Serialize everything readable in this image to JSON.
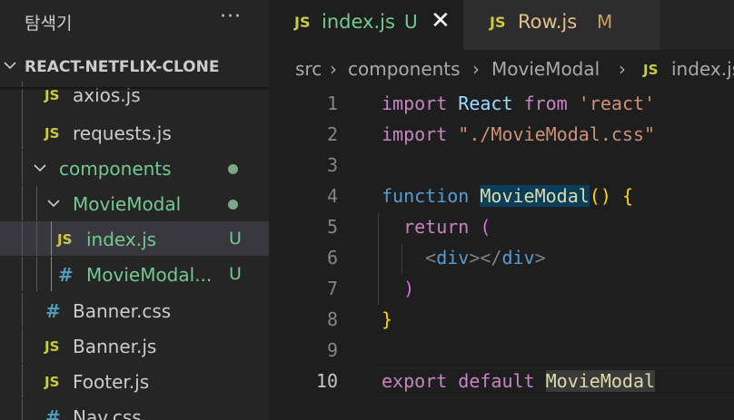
{
  "sidebar": {
    "title": "탐색기",
    "more": "···",
    "project": "REACT-NETFLIX-CLONE",
    "items": [
      {
        "type": "js",
        "name": "axios.js"
      },
      {
        "type": "js",
        "name": "requests.js"
      },
      {
        "type": "folder",
        "name": "components"
      },
      {
        "type": "folder",
        "name": "MovieModal"
      },
      {
        "type": "js",
        "name": "index.js",
        "badge": "U"
      },
      {
        "type": "css",
        "name": "MovieModal...",
        "badge": "U"
      },
      {
        "type": "css",
        "name": "Banner.css"
      },
      {
        "type": "js",
        "name": "Banner.js"
      },
      {
        "type": "js",
        "name": "Footer.js"
      },
      {
        "type": "css",
        "name": "Nav.css"
      }
    ]
  },
  "icons": {
    "js": "JS",
    "css": "#"
  },
  "tabs": [
    {
      "name": "index.js",
      "badge": "U",
      "close": "✕"
    },
    {
      "name": "Row.js",
      "badge": "M"
    }
  ],
  "breadcrumb": {
    "parts": [
      "src",
      "components",
      "MovieModal",
      "index.js"
    ],
    "separator": "›"
  },
  "editor": {
    "line_numbers": [
      "1",
      "2",
      "3",
      "4",
      "5",
      "6",
      "7",
      "8",
      "9",
      "10"
    ],
    "line1": {
      "kw": "import",
      "id": "React",
      "from": "from",
      "str": "'react'"
    },
    "line2": {
      "kw": "import",
      "str": "\"./MovieModal.css\""
    },
    "line4": {
      "kw": "function",
      "fn": "MovieModal",
      "parens": "()",
      "brace": "{"
    },
    "line5": {
      "kw": "return",
      "paren": "("
    },
    "line6": {
      "open_lt": "<",
      "tag1": "div",
      "mid": "></",
      "tag2": "div",
      "close_gt": ">"
    },
    "line7": {
      "paren": ")"
    },
    "line8": {
      "brace": "}"
    },
    "line10": {
      "kw1": "export",
      "kw2": "default",
      "id": "MovieModal"
    }
  },
  "colors": {
    "js_icon": "#cbcb41",
    "css_icon": "#519aba",
    "untracked": "#73c991",
    "modified": "#c6a05e"
  }
}
